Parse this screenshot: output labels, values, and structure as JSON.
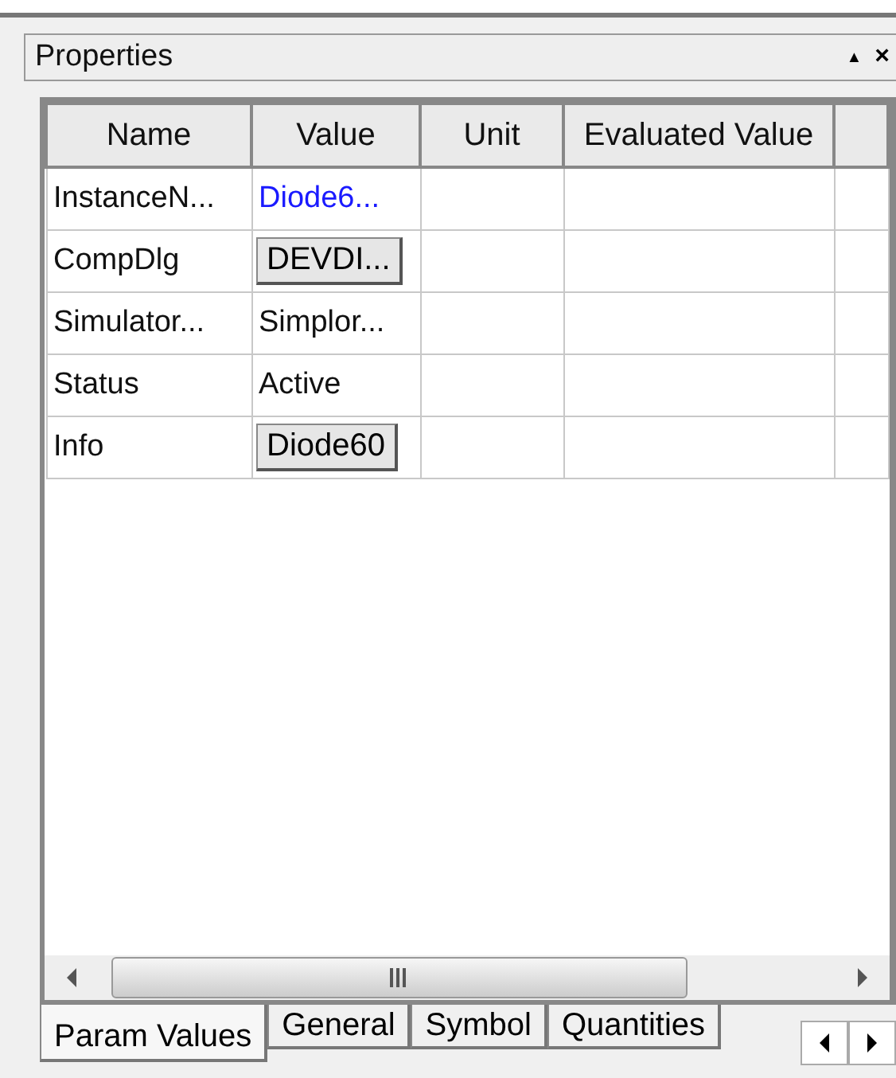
{
  "panel": {
    "title": "Properties",
    "pin_icon": "▲",
    "close_icon": "×"
  },
  "table": {
    "columns": [
      "Name",
      "Value",
      "Unit",
      "Evaluated Value"
    ],
    "rows": [
      {
        "name": "InstanceN...",
        "value": {
          "kind": "link",
          "text": "Diode6..."
        }
      },
      {
        "name": "CompDlg",
        "value": {
          "kind": "button",
          "text": "DEVDI..."
        }
      },
      {
        "name": "Simulator...",
        "value": {
          "kind": "text",
          "text": "Simplor..."
        }
      },
      {
        "name": "Status",
        "value": {
          "kind": "text",
          "text": "Active"
        }
      },
      {
        "name": "Info",
        "value": {
          "kind": "button",
          "text": "Diode60"
        }
      }
    ]
  },
  "tabs": [
    {
      "label": "Param Values",
      "selected": true
    },
    {
      "label": "General",
      "selected": false
    },
    {
      "label": "Symbol",
      "selected": false
    },
    {
      "label": "Quantities",
      "selected": false
    }
  ]
}
